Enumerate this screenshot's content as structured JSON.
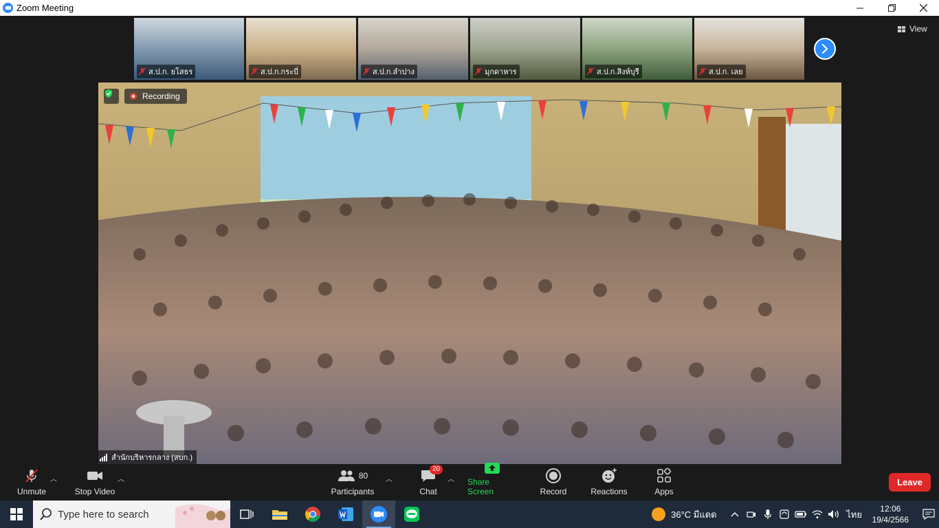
{
  "window": {
    "title": "Zoom Meeting"
  },
  "thumbnails": [
    {
      "name": "ส.ป.ก. ยโสธร",
      "bg": "#6f8aa6"
    },
    {
      "name": "ส.ป.ก.กระบี่",
      "bg": "#b79c78"
    },
    {
      "name": "ส.ป.ก.ลำปาง",
      "bg": "#a9a39b"
    },
    {
      "name": "มุกดาหาร",
      "bg": "#8d9388"
    },
    {
      "name": "ส.ป.ก.สิงห์บุรี",
      "bg": "#7f8f7a"
    },
    {
      "name": "ส.ป.ก. เลย",
      "bg": "#a99a88"
    }
  ],
  "view_label": "View",
  "main_video": {
    "recording_label": "Recording",
    "speaker_name": "สำนักบริหารกลาง (สบก.)"
  },
  "toolbar": {
    "unmute": "Unmute",
    "stop_video": "Stop Video",
    "participants": "Participants",
    "participants_count": "80",
    "chat": "Chat",
    "chat_badge": "20",
    "share_screen": "Share Screen",
    "record": "Record",
    "reactions": "Reactions",
    "apps": "Apps",
    "leave": "Leave"
  },
  "taskbar": {
    "search_placeholder": "Type here to search",
    "weather": "36°C มีแดด",
    "language": "ไทย",
    "time": "12:06",
    "date": "19/4/2566"
  },
  "colors": {
    "zoom_blue": "#2d8cff",
    "leave_red": "#e02828",
    "share_green": "#23d959"
  }
}
